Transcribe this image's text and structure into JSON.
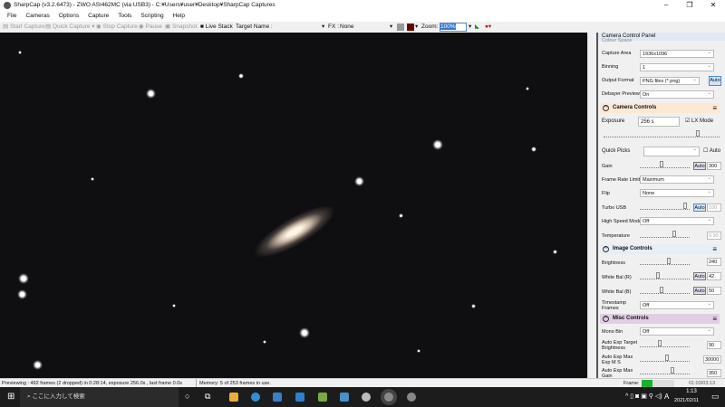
{
  "window": {
    "title": "SharpCap (v3.2.6473) - ZWO ASI462MC (via USB3) - C:¥Users¥user¥Desktop¥SharpCap Captures"
  },
  "menu": [
    "File",
    "Cameras",
    "Options",
    "Capture",
    "Tools",
    "Scripting",
    "Help"
  ],
  "toolbar": {
    "start_capture": "Start Capture",
    "quick_capture": "Quick Capture",
    "stop_capture": "Stop Capture",
    "pause": "Pause",
    "snapshot": "Snapshot",
    "live_stack": "Live Stack",
    "target_name": "Target Name :",
    "fx_label": "FX :",
    "fx_value": "None",
    "zoom_label": "Zoom:",
    "zoom_value": "100%"
  },
  "panel": {
    "title": "Camera Control Panel",
    "colour_space": "Colour Space",
    "capture_area": {
      "label": "Capture Area",
      "value": "1936x1096"
    },
    "binning": {
      "label": "Binning",
      "value": "1"
    },
    "output_format": {
      "label": "Output Format",
      "value": "PNG files (*.png)",
      "auto": "Auto"
    },
    "debayer": {
      "label": "Debayer Preview",
      "value": "On"
    },
    "camera_controls": "Camera Controls",
    "exposure": {
      "label": "Exposure",
      "value": "256 s",
      "lx_mode": "LX Mode"
    },
    "quick_picks": {
      "label": "Quick Picks",
      "auto": "Auto"
    },
    "gain": {
      "label": "Gain",
      "auto": "Auto",
      "value": "300"
    },
    "frame_rate": {
      "label": "Frame Rate Limit",
      "value": "Maximum"
    },
    "flip": {
      "label": "Flip",
      "value": "None"
    },
    "turbo": {
      "label": "Turbo USB",
      "auto": "Auto",
      "value": "100"
    },
    "high_speed": {
      "label": "High Speed Mode",
      "value": "Off"
    },
    "temperature": {
      "label": "Temperature",
      "value": "9.90"
    },
    "image_controls": "Image Controls",
    "brightness": {
      "label": "Brightness",
      "value": "240"
    },
    "wb_r": {
      "label": "White Bal (R)",
      "auto": "Auto",
      "value": "42"
    },
    "wb_b": {
      "label": "White Bal (B)",
      "auto": "Auto",
      "value": "50"
    },
    "timestamp": {
      "label": "Timestamp Frames",
      "value": "Off"
    },
    "misc_controls": "Misc Controls",
    "mono_bin": {
      "label": "Mono Bin",
      "value": "Off"
    },
    "ae_target": {
      "label": "Auto Exp Target Brightness",
      "value": "90"
    },
    "ae_max_exp": {
      "label": "Auto Exp Max Exp M S",
      "value": "30000"
    },
    "ae_max_gain": {
      "label": "Auto Exp Max Gain",
      "value": "350"
    }
  },
  "status": {
    "preview": "Previewing : 492 frames (2 dropped) in 0:28:14, exposure 256.0s , last frame 0.0s",
    "memory": "Memory: 5 of 253 frames in use.",
    "frame_label": "Frame:",
    "frame_time": "01:03/03:13"
  },
  "taskbar": {
    "search": "ここに入力して検索",
    "time": "1:13",
    "date": "2021/02/11",
    "ime": "A"
  },
  "colors": {
    "camera_header": "#fbe9d4",
    "image_header": "#e6eef7",
    "misc_header": "#e3cde6",
    "frame_progress": "#1db030"
  }
}
